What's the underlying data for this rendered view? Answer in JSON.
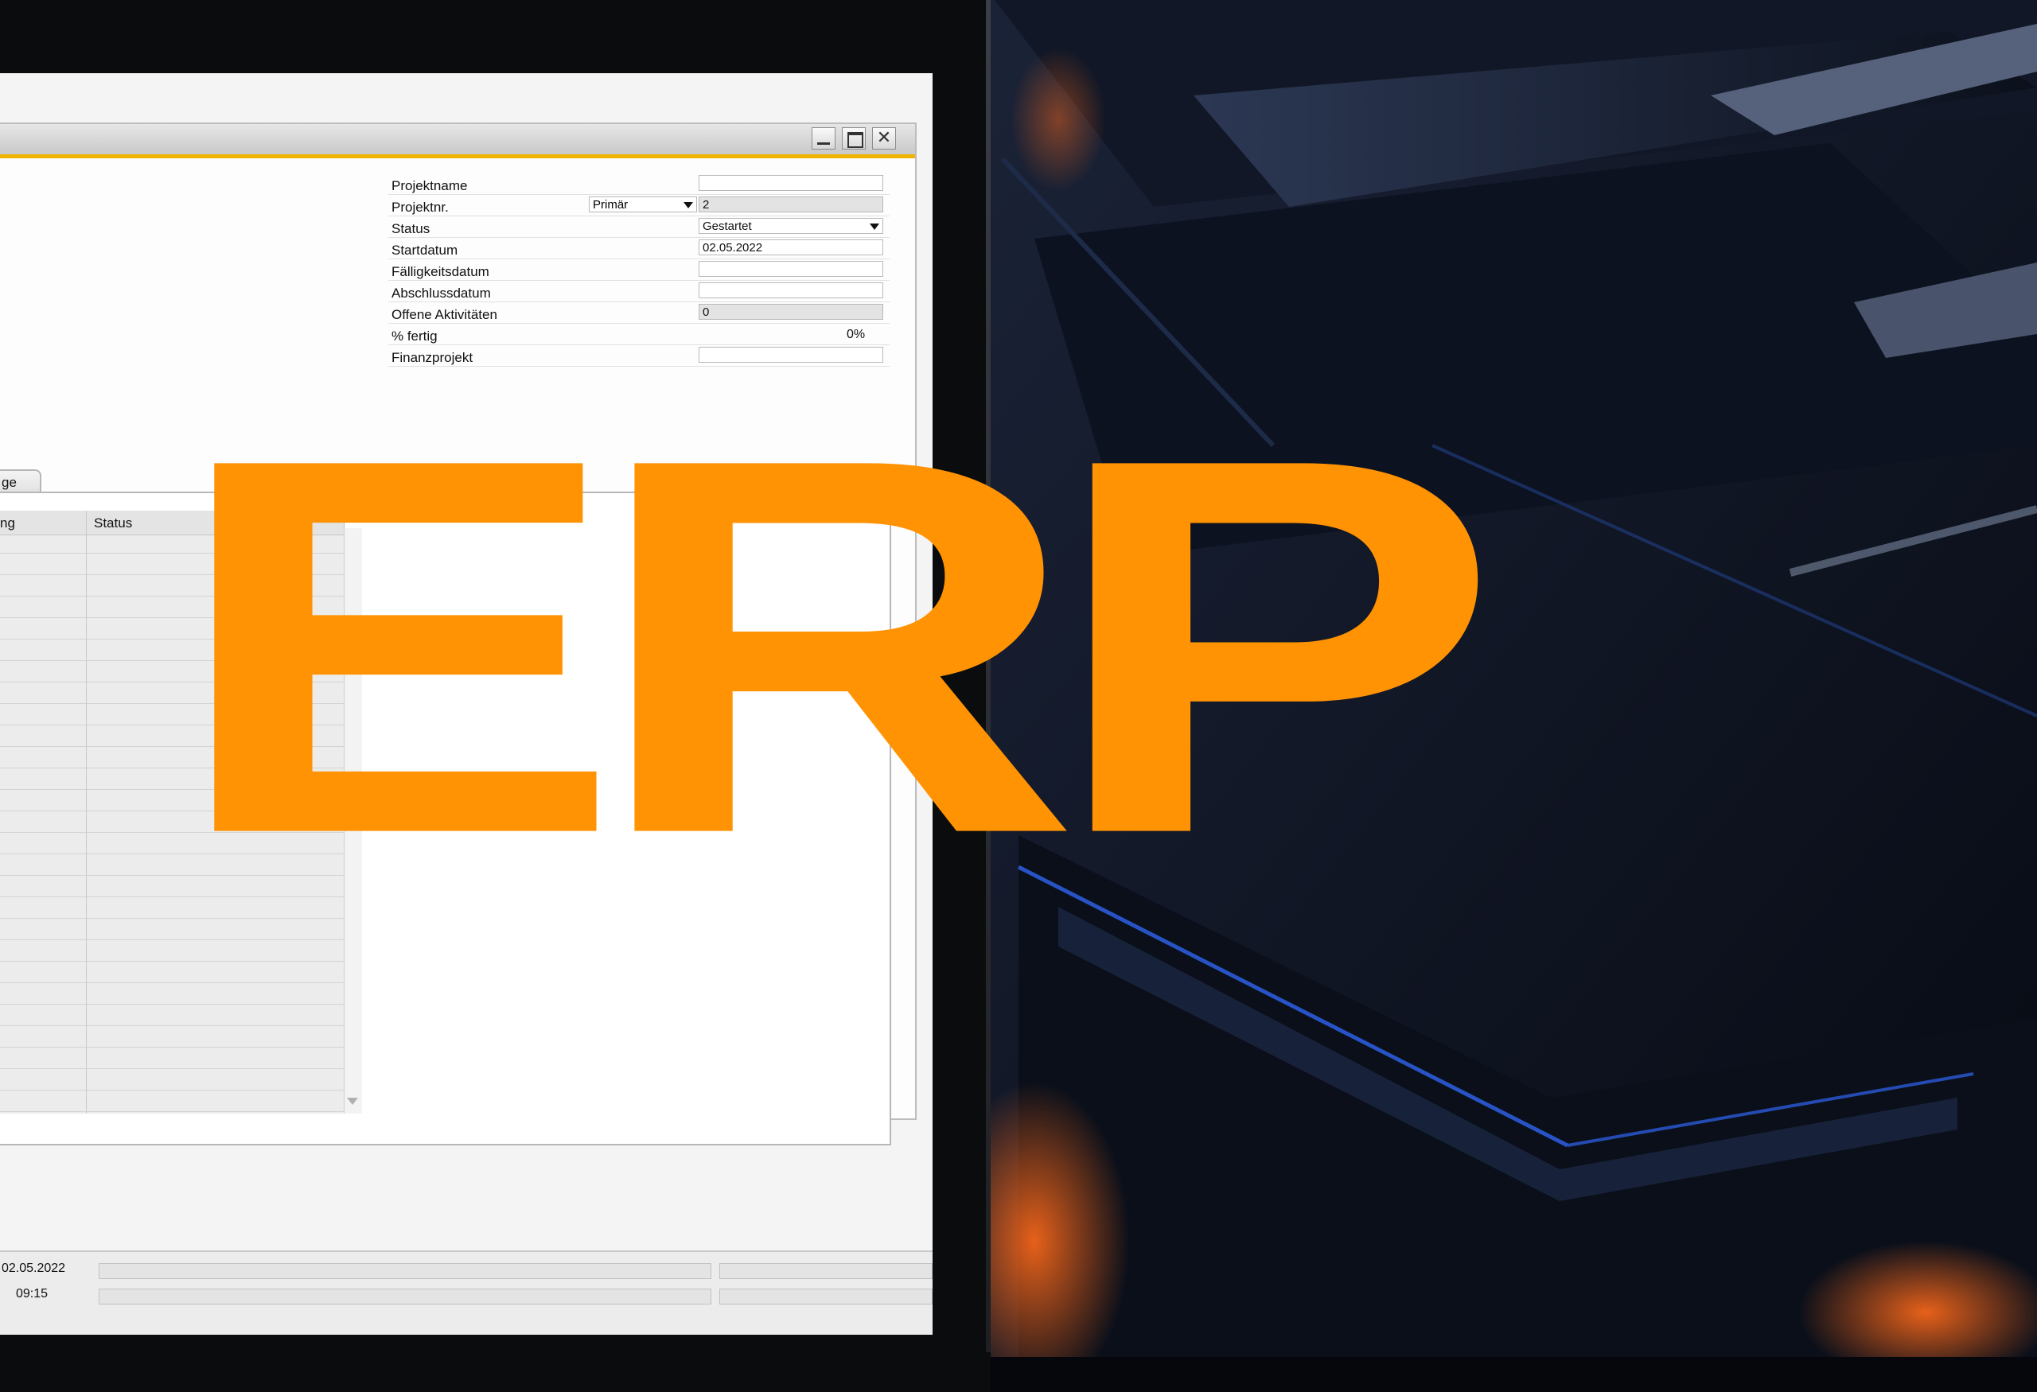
{
  "colors": {
    "accent": "#ff9303",
    "titlebar_stripe": "#f0b400",
    "background": "#05070d"
  },
  "logo": {
    "text": "ERP"
  },
  "window": {
    "buttons": {
      "minimize_icon": "minimize-icon",
      "maximize_icon": "maximize-icon",
      "close_icon": "close-icon",
      "close_glyph": "✕"
    },
    "fields": {
      "projektname": {
        "label": "Projektname",
        "value": ""
      },
      "projektnr": {
        "label": "Projektnr.",
        "series": "Primär",
        "value": "2"
      },
      "status": {
        "label": "Status",
        "value": "Gestartet"
      },
      "startdatum": {
        "label": "Startdatum",
        "value": "02.05.2022"
      },
      "faelligkeitsdatum": {
        "label": "Fälligkeitsdatum",
        "value": ""
      },
      "abschlussdatum": {
        "label": "Abschlussdatum",
        "value": ""
      },
      "offene_aktivitaeten": {
        "label": "Offene Aktivitäten",
        "value": "0"
      },
      "prozent_fertig": {
        "label": "% fertig",
        "value": "0%"
      },
      "finanzprojekt": {
        "label": "Finanzprojekt",
        "value": ""
      }
    },
    "tab": {
      "label": "ge"
    },
    "grid": {
      "columns": [
        "ng",
        "Status"
      ],
      "expand_glyph": "↗"
    },
    "statusbar": {
      "date": "02.05.2022",
      "time": "09:15"
    }
  }
}
